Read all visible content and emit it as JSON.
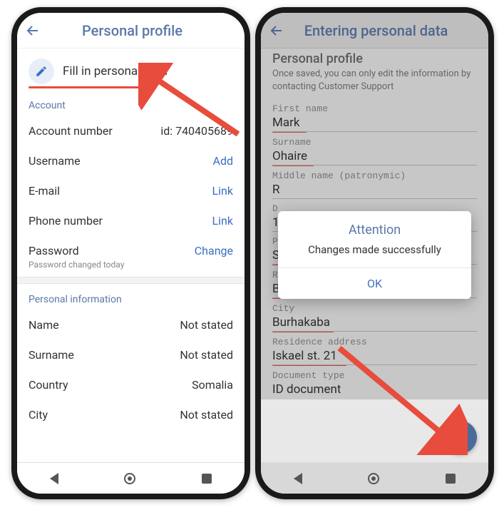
{
  "left": {
    "header_title": "Personal profile",
    "fill_label": "Fill in personal data",
    "account_section": "Account",
    "rows": {
      "account_number_label": "Account number",
      "account_number_value": "id: 740405689",
      "username_label": "Username",
      "username_action": "Add",
      "email_label": "E-mail",
      "email_action": "Link",
      "phone_label": "Phone number",
      "phone_action": "Link",
      "password_label": "Password",
      "password_action": "Change",
      "password_sub": "Password changed today"
    },
    "personal_section": "Personal information",
    "personal": {
      "name_label": "Name",
      "name_value": "Not stated",
      "surname_label": "Surname",
      "surname_value": "Not stated",
      "country_label": "Country",
      "country_value": "Somalia",
      "city_label": "City",
      "city_value": "Not stated"
    }
  },
  "right": {
    "header_title": "Entering personal data",
    "subheader": "Personal profile",
    "note": "Once saved, you can only edit the information by contacting Customer Support",
    "fields": {
      "first_name_label": "First name",
      "first_name_value": "Mark",
      "surname_label": "Surname",
      "surname_value": "Ohaire",
      "middle_label": "Middle name (patronymic)",
      "middle_value": "R",
      "dob_label": "D",
      "dob_value": "19",
      "place_label": "Pl",
      "place_value": "SOMALIA",
      "region_label": "Region",
      "region_value": "Bay",
      "city_label": "City",
      "city_value": "Burhakaba",
      "address_label": "Residence address",
      "address_value": "Iskael st. 21",
      "doctype_label": "Document type",
      "doctype_value": "ID document"
    },
    "modal": {
      "title": "Attention",
      "body": "Changes made successfully",
      "ok": "OK"
    }
  }
}
